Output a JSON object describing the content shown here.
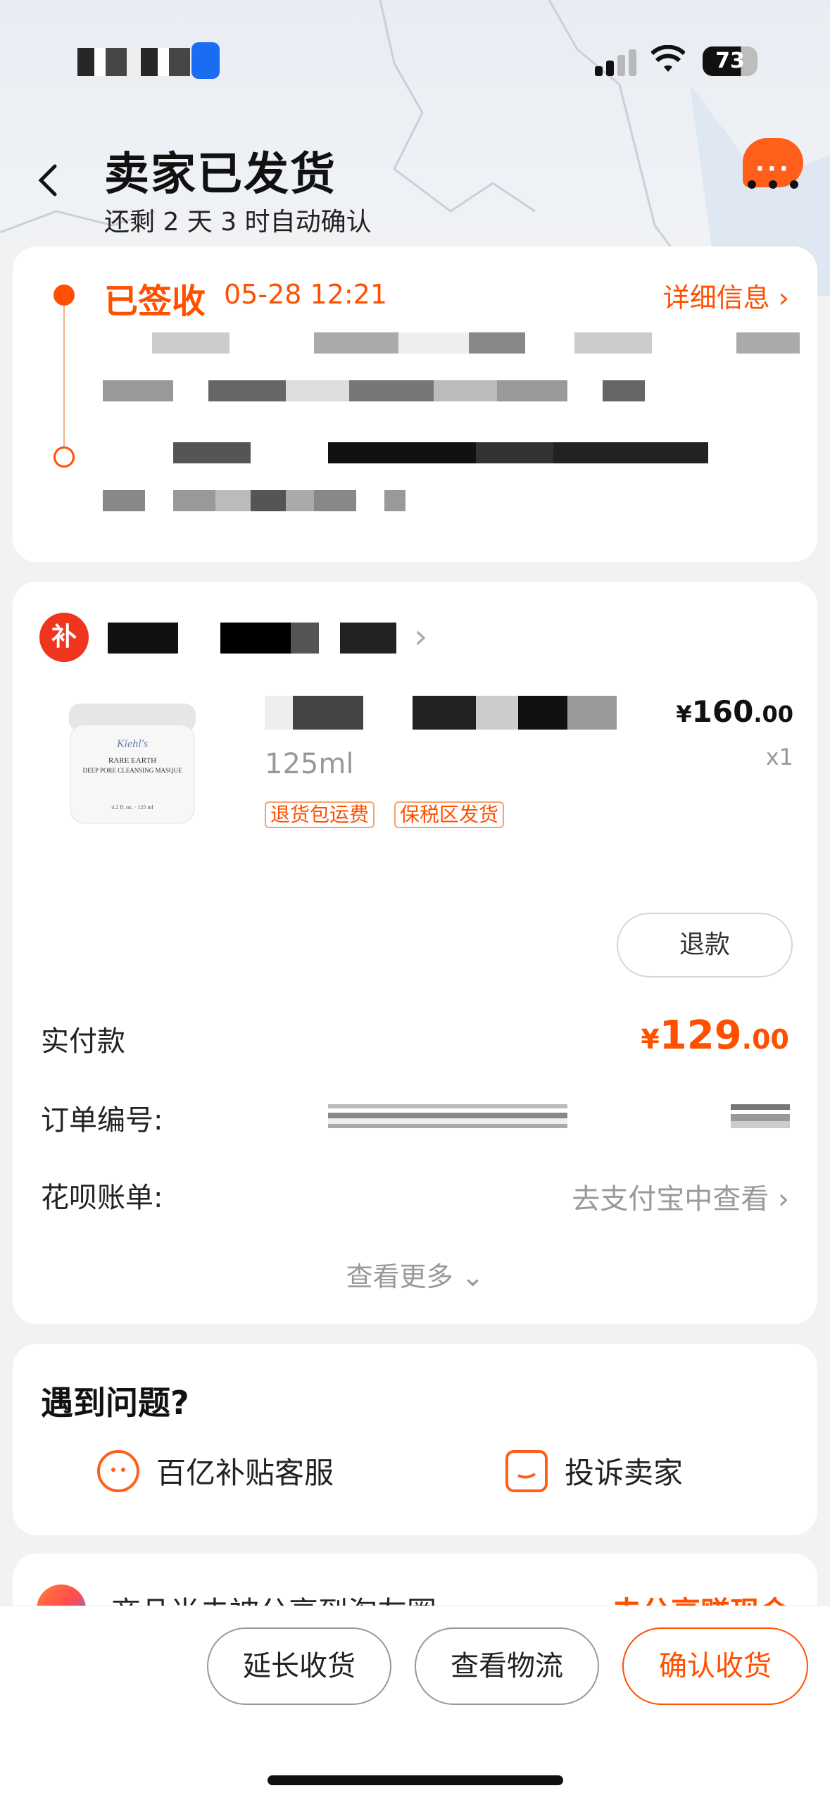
{
  "status_bar": {
    "battery": "73"
  },
  "header": {
    "title": "卖家已发货",
    "subtitle": "还剩 2 天 3 时自动确认",
    "more_label": "···"
  },
  "logistics": {
    "status": "已签收",
    "time": "05-28 12:21",
    "detail_link": "详细信息 ›"
  },
  "order": {
    "shop_badge": "补",
    "product": {
      "variant": "125ml",
      "tags": [
        "退货包运费",
        "保税区发货"
      ],
      "price_symbol": "¥",
      "price_int": "160",
      "price_dec": ".00",
      "quantity": "x1",
      "image_brand": "Kiehl's",
      "image_line1": "RARE EARTH",
      "image_line2": "DEEP PORE CLEANSING MASQUE",
      "image_size": "4.2 fl. oz. · 125 ml"
    },
    "refund_button": "退款",
    "paid_label": "实付款",
    "paid_symbol": "¥",
    "paid_int": "129",
    "paid_dec": ".00",
    "order_no_label": "订单编号:",
    "huabei_label": "花呗账单:",
    "huabei_link": "去支付宝中查看",
    "see_more": "查看更多"
  },
  "problem": {
    "title": "遇到问题?",
    "service": "百亿补贴客服",
    "complain": "投诉卖家"
  },
  "share": {
    "text": "商品尚未被分享到淘友圈",
    "link": "去分享赚现金"
  },
  "bottom": {
    "extend": "延长收货",
    "logistics": "查看物流",
    "confirm": "确认收货"
  },
  "colors": {
    "accent": "#ff5000",
    "badge": "#f0351f"
  }
}
